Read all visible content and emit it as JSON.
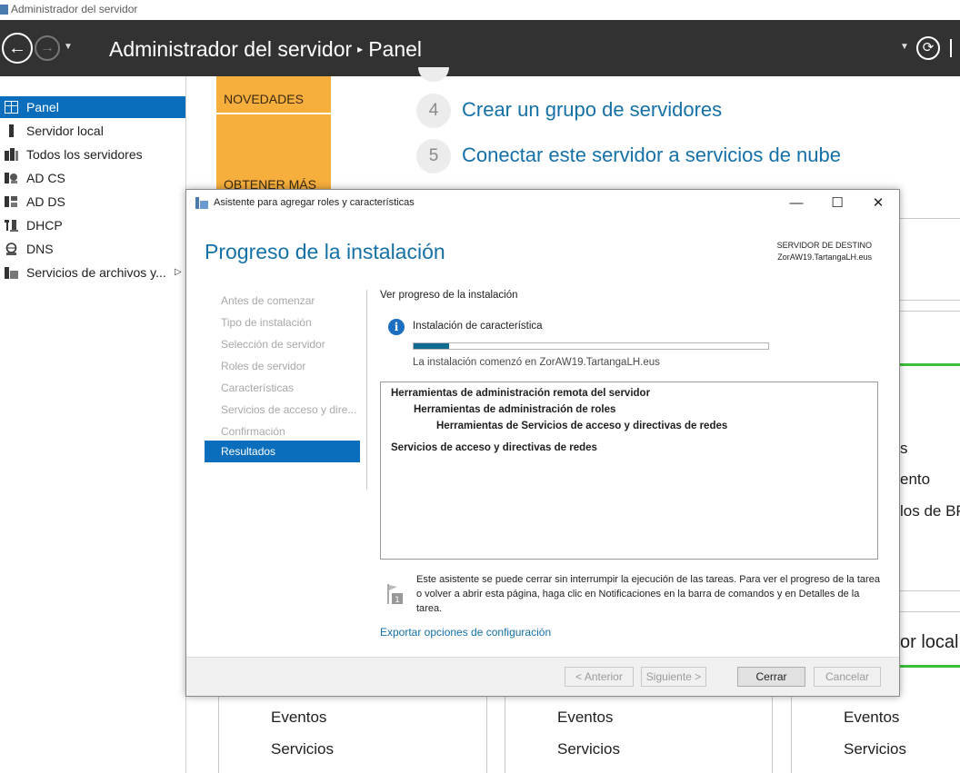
{
  "window": {
    "title": "Administrador del servidor"
  },
  "header": {
    "app_title": "Administrador del servidor",
    "separator": "▸",
    "page": "Panel"
  },
  "sidebar": {
    "items": [
      {
        "label": "Panel",
        "icon": "dashboard-icon",
        "selected": true
      },
      {
        "label": "Servidor local",
        "icon": "server-icon"
      },
      {
        "label": "Todos los servidores",
        "icon": "servers-icon"
      },
      {
        "label": "AD CS",
        "icon": "ad-cs-icon"
      },
      {
        "label": "AD DS",
        "icon": "ad-ds-icon"
      },
      {
        "label": "DHCP",
        "icon": "dhcp-icon"
      },
      {
        "label": "DNS",
        "icon": "dns-icon"
      },
      {
        "label": "Servicios de archivos y...",
        "icon": "file-services-icon",
        "has_submenu": true
      }
    ]
  },
  "dashboard": {
    "tile_news": "NOVEDADES",
    "tile_more": "OBTENER MÁS",
    "steps": [
      {
        "num": "4",
        "label": "Crear un grupo de servidores"
      },
      {
        "num": "5",
        "label": "Conectar este servidor a servicios de nube"
      }
    ],
    "right_fragments": [
      "s",
      "ento",
      "los de BP",
      "or local"
    ],
    "bottom_tiles": [
      {
        "events": "Eventos",
        "services": "Servicios"
      },
      {
        "events": "Eventos",
        "services": "Servicios"
      },
      {
        "events": "Eventos",
        "services": "Servicios"
      }
    ]
  },
  "dialog": {
    "title": "Asistente para agregar roles y características",
    "heading": "Progreso de la instalación",
    "dest_label": "SERVIDOR DE DESTINO",
    "dest_value": "ZorAW19.TartangaLH.eus",
    "steps": [
      "Antes de comenzar",
      "Tipo de instalación",
      "Selección de servidor",
      "Roles de servidor",
      "Características",
      "Servicios de acceso y dire...",
      "Confirmación",
      "Resultados"
    ],
    "selected_step": "Resultados",
    "section_label": "Ver progreso de la instalación",
    "feature_label": "Instalación de característica",
    "progress": 0.1,
    "started_text": "La instalación comenzó en ZorAW19.TartangaLH.eus",
    "feature_list": [
      "Herramientas de administración remota del servidor",
      "Herramientas de administración de roles",
      "Herramientas de Servicios de acceso y directivas de redes",
      "Servicios de acceso y directivas de redes"
    ],
    "note": "Este asistente se puede cerrar sin interrumpir la ejecución de las tareas. Para ver el progreso de la tarea o volver a abrir esta página, haga clic en Notificaciones en la barra de comandos y en Detalles de la tarea.",
    "export_link": "Exportar opciones de configuración",
    "buttons": {
      "prev": "< Anterior",
      "next": "Siguiente >",
      "close": "Cerrar",
      "cancel": "Cancelar"
    },
    "window_controls": {
      "minimize": "—",
      "maximize": "☐",
      "close": "✕"
    }
  },
  "colors": {
    "header_bg": "#323232",
    "accent_blue": "#0a6ebd",
    "link_blue": "#1570a6",
    "tile_orange": "#f6ae3c",
    "progress_fill": "#0e6a8e",
    "status_green": "#3cbf3c"
  }
}
